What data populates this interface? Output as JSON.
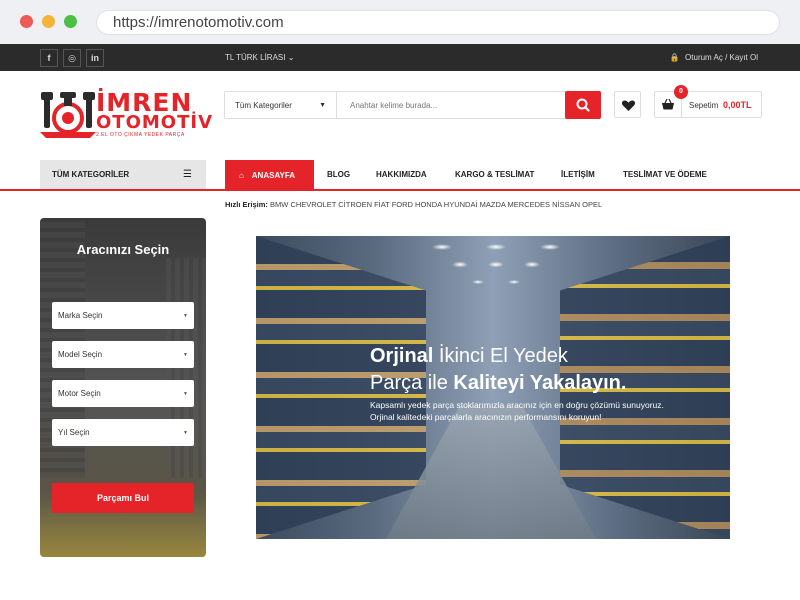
{
  "browser": {
    "url": "https://imrenotomotiv.com"
  },
  "topbar": {
    "social": [
      "f",
      "◎",
      "in"
    ],
    "currency": "TL TÜRK LİRASI",
    "currency_caret": "⌄",
    "login": "Oturum Aç",
    "divider": "/",
    "register": "Kayıt Ol"
  },
  "logo": {
    "line1": "İMREN",
    "line2": "OTOMOTİV",
    "tagline": "2.EL OTO ÇIKMA YEDEK PARÇA"
  },
  "search": {
    "category": "Tüm Kategoriler",
    "placeholder": "Anahtar kelime burada..."
  },
  "cart": {
    "count": "0",
    "label": "Sepetim",
    "total": "0,00TL"
  },
  "nav": {
    "all_categories": "TÜM KATEGORİLER",
    "home": "ANASAYFA",
    "items": [
      "BLOG",
      "HAKKIMIZDA",
      "KARGO & TESLİMAT",
      "İLETİŞİM",
      "TESLİMAT VE ÖDEME"
    ]
  },
  "quick_access": {
    "label": "Hızlı Erişim:",
    "brands": "BMW CHEVROLET CİTROEN FİAT FORD HONDA HYUNDAİ MAZDA MERCEDES NİSSAN OPEL"
  },
  "finder": {
    "title": "Aracınızı Seçin",
    "selects": [
      "Marka Seçin",
      "Model Seçin",
      "Motor Seçin",
      "Yıl Seçin"
    ],
    "button": "Parçamı Bul"
  },
  "hero": {
    "line1_bold": "Orjinal",
    "line1_rest": " İkinci El Yedek",
    "line2_start": "Parça ile ",
    "line2_bold": "Kaliteyi Yakalayın.",
    "para1": "Kapsamlı yedek parça stoklarımızla aracınız için en doğru çözümü sunuyoruz.",
    "para2": "Orjinal kalitedeki parçalarla aracınızın performansını koruyun!"
  },
  "colors": {
    "accent": "#e5242a",
    "topbar": "#2b2b2b"
  }
}
